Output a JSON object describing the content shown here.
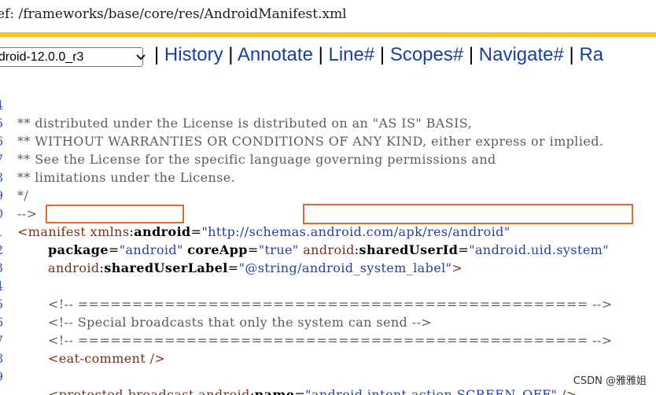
{
  "path": "ef: /frameworks/base/core/res/AndroidManifest.xml",
  "version_select": {
    "value": "ndroid-12.0.0_r3"
  },
  "nav": {
    "links": [
      "History",
      "Annotate",
      "Line#",
      "Scopes#",
      "Navigate#",
      "Ra"
    ]
  },
  "code_lines": [
    {
      "no": "4",
      "text": "** distributed under the License is distributed on an \"AS IS\" BASIS,"
    },
    {
      "no": "5",
      "text": "** WITHOUT WARRANTIES OR CONDITIONS OF ANY KIND, either express or implied."
    },
    {
      "no": "6",
      "text": "** See the License for the specific language governing permissions and"
    },
    {
      "no": "7",
      "text": "** limitations under the License."
    },
    {
      "no": "8",
      "text": "*/"
    },
    {
      "no": "9",
      "text": "-->"
    },
    {
      "no": "0",
      "p1": "<manifest xmlns",
      "p2": ":",
      "p3": "android",
      "p4": "=",
      "p5": "\"http://schemas.android.com/apk/res/android\""
    },
    {
      "no": "1",
      "a1": "package",
      "e1": "=",
      "v1": "\"android\"",
      "a2": "coreApp",
      "e2": "=",
      "v2": "\"true\"",
      "ns3": "android",
      "c3": ":",
      "a3": "sharedUserId",
      "e3": "=",
      "v3": "\"android.uid.system\""
    },
    {
      "no": "2",
      "ns": "android",
      "c": ":",
      "a": "sharedUserLabel",
      "e": "=",
      "v": "\"@string/android_system_label\"",
      "end": ">"
    },
    {
      "no": "3",
      "text": ""
    },
    {
      "no": "4",
      "text": "<!-- =============================================== -->"
    },
    {
      "no": "5",
      "text": "<!-- Special broadcasts that only the system can send -->"
    },
    {
      "no": "6",
      "text": "<!-- =============================================== -->"
    },
    {
      "no": "7",
      "text": "<eat-comment />"
    },
    {
      "no": "8",
      "text": ""
    },
    {
      "no": "9",
      "p1": "<protected-broadcast ",
      "ns": "android",
      "c": ":",
      "a": "name",
      "e": "=",
      "v": "\"android.intent.action.SCREEN_OFF\"",
      "end": " />"
    }
  ],
  "watermark": "CSDN @雅雅姐",
  "colors": {
    "highlight_box": "#e46a2c",
    "accent_band": "#f8c420",
    "link": "#1a3fa0"
  }
}
